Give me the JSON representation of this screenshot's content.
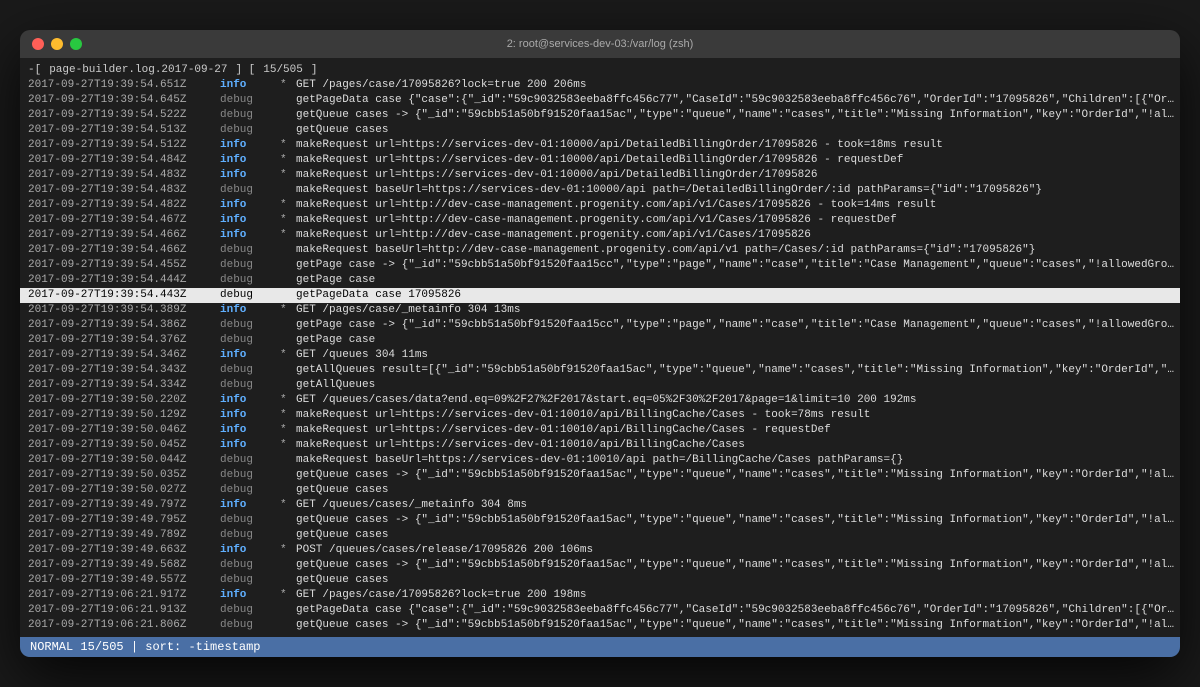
{
  "window": {
    "title": "2: root@services-dev-03:/var/log (zsh)"
  },
  "header": {
    "file": "page-builder.log",
    "date": "2017-09-27",
    "position": "15/505"
  },
  "statusBar": {
    "mode": "NORMAL",
    "position": "15/505",
    "sort": "sort: -timestamp"
  },
  "trafficLights": {
    "close": "close",
    "minimize": "minimize",
    "maximize": "maximize"
  },
  "logLines": [
    {
      "timestamp": "2017-09-27T19:39:54.651Z",
      "level": "info",
      "star": "*",
      "message": "GET /pages/case/17095826?lock=true 200 206ms",
      "highlighted": false
    },
    {
      "timestamp": "2017-09-27T19:39:54.645Z",
      "level": "debug",
      "star": "",
      "message": "getPageData case {\"case\":{\"_id\":\"59c9032583eeba8ffc456c77\",\"CaseId\":\"59c9032583eeba8ffc456c76\",\"OrderId\":\"17095826\",\"Children\":[{\"Order",
      "highlighted": false
    },
    {
      "timestamp": "2017-09-27T19:39:54.522Z",
      "level": "debug",
      "star": "",
      "message": "getQueue cases -> {\"_id\":\"59cbb51a50bf91520faa15ac\",\"type\":\"queue\",\"name\":\"cases\",\"title\":\"Missing Information\",\"key\":\"OrderId\",\"!allow",
      "highlighted": false
    },
    {
      "timestamp": "2017-09-27T19:39:54.513Z",
      "level": "debug",
      "star": "",
      "message": "getQueue cases",
      "highlighted": false
    },
    {
      "timestamp": "2017-09-27T19:39:54.512Z",
      "level": "info",
      "star": "*",
      "message": "makeRequest url=https://services-dev-01:10000/api/DetailedBillingOrder/17095826 - took=18ms result",
      "highlighted": false
    },
    {
      "timestamp": "2017-09-27T19:39:54.484Z",
      "level": "info",
      "star": "*",
      "message": "makeRequest url=https://services-dev-01:10000/api/DetailedBillingOrder/17095826 - requestDef",
      "highlighted": false
    },
    {
      "timestamp": "2017-09-27T19:39:54.483Z",
      "level": "info",
      "star": "*",
      "message": "makeRequest url=https://services-dev-01:10000/api/DetailedBillingOrder/17095826",
      "highlighted": false
    },
    {
      "timestamp": "2017-09-27T19:39:54.483Z",
      "level": "debug",
      "star": "",
      "message": "makeRequest baseUrl=https://services-dev-01:10000/api path=/DetailedBillingOrder/:id pathParams={\"id\":\"17095826\"}",
      "highlighted": false
    },
    {
      "timestamp": "2017-09-27T19:39:54.482Z",
      "level": "info",
      "star": "*",
      "message": "makeRequest url=http://dev-case-management.progenity.com/api/v1/Cases/17095826 - took=14ms result",
      "highlighted": false
    },
    {
      "timestamp": "2017-09-27T19:39:54.467Z",
      "level": "info",
      "star": "*",
      "message": "makeRequest url=http://dev-case-management.progenity.com/api/v1/Cases/17095826 - requestDef",
      "highlighted": false
    },
    {
      "timestamp": "2017-09-27T19:39:54.466Z",
      "level": "info",
      "star": "*",
      "message": "makeRequest url=http://dev-case-management.progenity.com/api/v1/Cases/17095826",
      "highlighted": false
    },
    {
      "timestamp": "2017-09-27T19:39:54.466Z",
      "level": "debug",
      "star": "",
      "message": "makeRequest baseUrl=http://dev-case-management.progenity.com/api/v1 path=/Cases/:id pathParams={\"id\":\"17095826\"}",
      "highlighted": false
    },
    {
      "timestamp": "2017-09-27T19:39:54.455Z",
      "level": "debug",
      "star": "",
      "message": "getPage case -> {\"_id\":\"59cbb51a50bf91520faa15cc\",\"type\":\"page\",\"name\":\"case\",\"title\":\"Case Management\",\"queue\":\"cases\",\"!allowedGroups",
      "highlighted": false
    },
    {
      "timestamp": "2017-09-27T19:39:54.444Z",
      "level": "debug",
      "star": "",
      "message": "getPage case",
      "highlighted": false
    },
    {
      "timestamp": "2017-09-27T19:39:54.443Z",
      "level": "debug",
      "star": "",
      "message": "getPageData case 17095826",
      "highlighted": true
    },
    {
      "timestamp": "2017-09-27T19:39:54.389Z",
      "level": "info",
      "star": "*",
      "message": "GET /pages/case/_metainfo 304 13ms",
      "highlighted": false
    },
    {
      "timestamp": "2017-09-27T19:39:54.386Z",
      "level": "debug",
      "star": "",
      "message": "getPage case -> {\"_id\":\"59cbb51a50bf91520faa15cc\",\"type\":\"page\",\"name\":\"case\",\"title\":\"Case Management\",\"queue\":\"cases\",\"!allowedGroups",
      "highlighted": false
    },
    {
      "timestamp": "2017-09-27T19:39:54.376Z",
      "level": "debug",
      "star": "",
      "message": "getPage case",
      "highlighted": false
    },
    {
      "timestamp": "2017-09-27T19:39:54.346Z",
      "level": "info",
      "star": "*",
      "message": "GET /queues 304 11ms",
      "highlighted": false
    },
    {
      "timestamp": "2017-09-27T19:39:54.343Z",
      "level": "debug",
      "star": "",
      "message": "getAllQueues result=[{\"_id\":\"59cbb51a50bf91520faa15ac\",\"type\":\"queue\",\"name\":\"cases\",\"title\":\"Missing Information\",\"key\":\"OrderId\",\"!al",
      "highlighted": false
    },
    {
      "timestamp": "2017-09-27T19:39:54.334Z",
      "level": "debug",
      "star": "",
      "message": "getAllQueues",
      "highlighted": false
    },
    {
      "timestamp": "2017-09-27T19:39:50.220Z",
      "level": "info",
      "star": "*",
      "message": "GET /queues/cases/data?end.eq=09%2F27%2F2017&start.eq=05%2F30%2F2017&page=1&limit=10 200 192ms",
      "highlighted": false
    },
    {
      "timestamp": "2017-09-27T19:39:50.129Z",
      "level": "info",
      "star": "*",
      "message": "makeRequest url=https://services-dev-01:10010/api/BillingCache/Cases - took=78ms result",
      "highlighted": false
    },
    {
      "timestamp": "2017-09-27T19:39:50.046Z",
      "level": "info",
      "star": "*",
      "message": "makeRequest url=https://services-dev-01:10010/api/BillingCache/Cases - requestDef",
      "highlighted": false
    },
    {
      "timestamp": "2017-09-27T19:39:50.045Z",
      "level": "info",
      "star": "*",
      "message": "makeRequest url=https://services-dev-01:10010/api/BillingCache/Cases",
      "highlighted": false
    },
    {
      "timestamp": "2017-09-27T19:39:50.044Z",
      "level": "debug",
      "star": "",
      "message": "makeRequest baseUrl=https://services-dev-01:10010/api path=/BillingCache/Cases pathParams={}",
      "highlighted": false
    },
    {
      "timestamp": "2017-09-27T19:39:50.035Z",
      "level": "debug",
      "star": "",
      "message": "getQueue cases -> {\"_id\":\"59cbb51a50bf91520faa15ac\",\"type\":\"queue\",\"name\":\"cases\",\"title\":\"Missing Information\",\"key\":\"OrderId\",\"!allow",
      "highlighted": false
    },
    {
      "timestamp": "2017-09-27T19:39:50.027Z",
      "level": "debug",
      "star": "",
      "message": "getQueue cases",
      "highlighted": false
    },
    {
      "timestamp": "2017-09-27T19:39:49.797Z",
      "level": "info",
      "star": "*",
      "message": "GET /queues/cases/_metainfo 304 8ms",
      "highlighted": false
    },
    {
      "timestamp": "2017-09-27T19:39:49.795Z",
      "level": "debug",
      "star": "",
      "message": "getQueue cases -> {\"_id\":\"59cbb51a50bf91520faa15ac\",\"type\":\"queue\",\"name\":\"cases\",\"title\":\"Missing Information\",\"key\":\"OrderId\",\"!allow",
      "highlighted": false
    },
    {
      "timestamp": "2017-09-27T19:39:49.789Z",
      "level": "debug",
      "star": "",
      "message": "getQueue cases",
      "highlighted": false
    },
    {
      "timestamp": "2017-09-27T19:39:49.663Z",
      "level": "info",
      "star": "*",
      "message": "POST /queues/cases/release/17095826 200 106ms",
      "highlighted": false
    },
    {
      "timestamp": "2017-09-27T19:39:49.568Z",
      "level": "debug",
      "star": "",
      "message": "getQueue cases -> {\"_id\":\"59cbb51a50bf91520faa15ac\",\"type\":\"queue\",\"name\":\"cases\",\"title\":\"Missing Information\",\"key\":\"OrderId\",\"!allow",
      "highlighted": false
    },
    {
      "timestamp": "2017-09-27T19:39:49.557Z",
      "level": "debug",
      "star": "",
      "message": "getQueue cases",
      "highlighted": false
    },
    {
      "timestamp": "2017-09-27T19:06:21.917Z",
      "level": "info",
      "star": "*",
      "message": "GET /pages/case/17095826?lock=true 200 198ms",
      "highlighted": false
    },
    {
      "timestamp": "2017-09-27T19:06:21.913Z",
      "level": "debug",
      "star": "",
      "message": "getPageData case {\"case\":{\"_id\":\"59c9032583eeba8ffc456c77\",\"CaseId\":\"59c9032583eeba8ffc456c76\",\"OrderId\":\"17095826\",\"Children\":[{\"Order",
      "highlighted": false
    },
    {
      "timestamp": "2017-09-27T19:06:21.806Z",
      "level": "debug",
      "star": "",
      "message": "getQueue cases -> {\"_id\":\"59cbb51a50bf91520faa15ac\",\"type\":\"queue\",\"name\":\"cases\",\"title\":\"Missing Information\",\"key\":\"OrderId\",\"!allow",
      "highlighted": false
    }
  ]
}
